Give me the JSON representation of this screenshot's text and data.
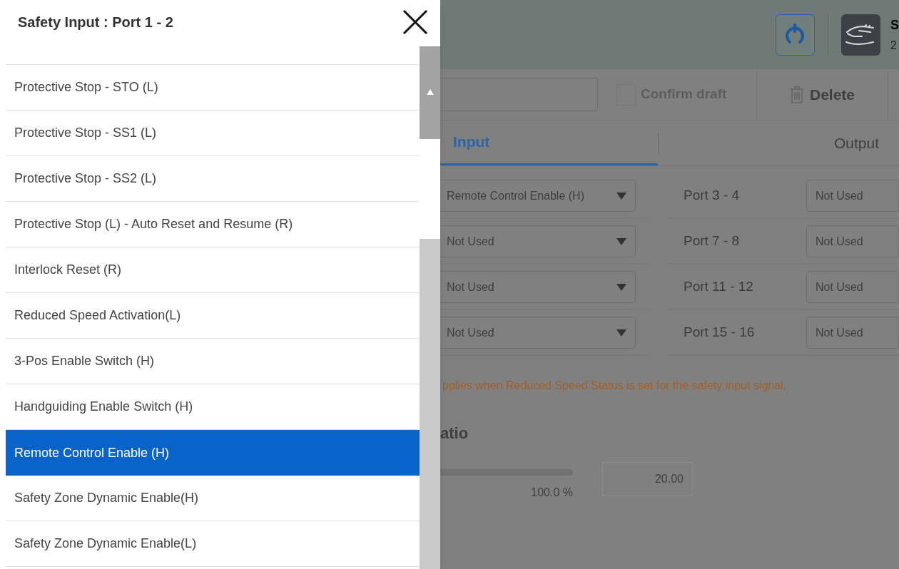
{
  "dialog": {
    "title": "Safety Input : Port 1 - 2",
    "items": [
      {
        "label": "Protective Stop - STO (L)",
        "selected": false
      },
      {
        "label": "Protective Stop - SS1 (L)",
        "selected": false
      },
      {
        "label": "Protective Stop - SS2 (L)",
        "selected": false
      },
      {
        "label": "Protective Stop (L) - Auto Reset and Resume (R)",
        "selected": false
      },
      {
        "label": "Interlock Reset (R)",
        "selected": false
      },
      {
        "label": "Reduced Speed Activation(L)",
        "selected": false
      },
      {
        "label": "3-Pos Enable Switch (H)",
        "selected": false
      },
      {
        "label": "Handguiding Enable Switch (H)",
        "selected": false
      },
      {
        "label": "Remote Control Enable (H)",
        "selected": true
      },
      {
        "label": "Safety Zone Dynamic Enable(H)",
        "selected": false
      },
      {
        "label": "Safety Zone Dynamic Enable(L)",
        "selected": false
      }
    ]
  },
  "header": {
    "user_name": "S",
    "user_detail": "2"
  },
  "toolbar": {
    "confirm_draft": {
      "label": "Confirm draft",
      "checked": false
    },
    "delete_button": "Delete"
  },
  "tabs": [
    {
      "label": "Input",
      "selected": true
    },
    {
      "label": "Output",
      "selected": false
    }
  ],
  "ports": [
    {
      "left_value": "Remote Control Enable (H)",
      "label": "Port 3 - 4",
      "right_value": "Not Used"
    },
    {
      "left_value": "Not Used",
      "label": "Port 7 - 8",
      "right_value": "Not Used"
    },
    {
      "left_value": "Not Used",
      "label": "Port 11 - 12",
      "right_value": "Not Used"
    },
    {
      "left_value": "Not Used",
      "label": "Port 15 - 16",
      "right_value": "Not Used"
    }
  ],
  "notice": "pplies when Reduced Speed Status is set for the safety input signal.",
  "section_title": "atio",
  "slider": {
    "level": 1,
    "reading": "100.0 %"
  },
  "ratio_field": {
    "value": "20.00"
  }
}
